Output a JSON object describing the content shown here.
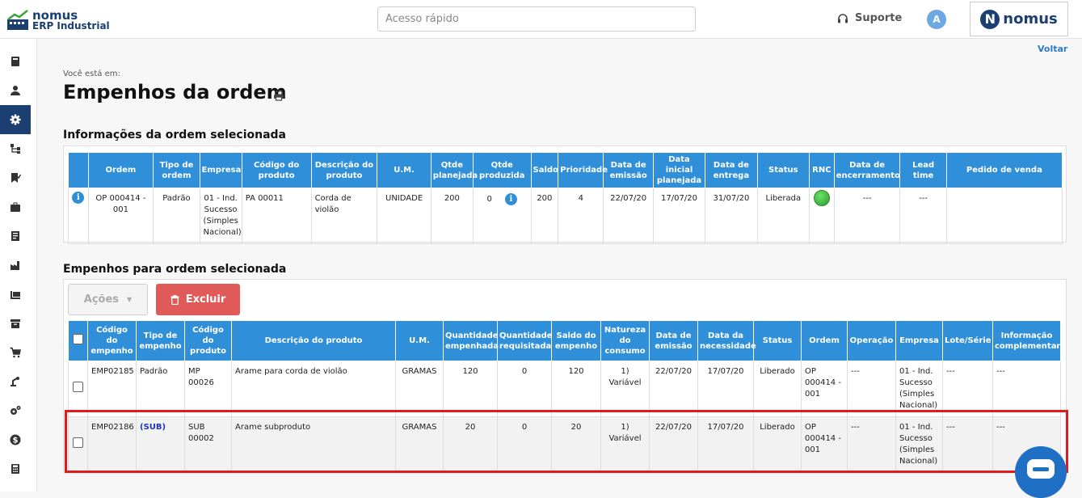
{
  "header": {
    "logo_line1": "nomus",
    "logo_line2": "ERP Industrial",
    "search_placeholder": "Acesso rápido",
    "support_label": "Suporte",
    "avatar_initial": "A",
    "brand": "nomus"
  },
  "sidebar": {
    "icons": [
      "book-icon",
      "user-icon",
      "gear-icon",
      "flow-icon",
      "bookmark-check-icon",
      "briefcase-icon",
      "document-icon",
      "factory-icon",
      "forklift-icon",
      "archive-icon",
      "cart-icon",
      "robot-arm-icon",
      "gears-icon",
      "dollar-icon",
      "calculator-icon"
    ],
    "active_index": 2
  },
  "page": {
    "back_link": "Voltar",
    "breadcrumb": "Você está em:",
    "title": "Empenhos da ordem"
  },
  "order_section": {
    "title": "Informações da ordem selecionada",
    "headers": [
      "",
      "Ordem",
      "Tipo de ordem",
      "Empresa",
      "Código do produto",
      "Descrição do produto",
      "U.M.",
      "Qtde planejada",
      "Qtde produzida",
      "Saldo",
      "Prioridade",
      "Data de emissão",
      "Data inicial planejada",
      "Data de entrega",
      "Status",
      "RNC",
      "Data de encerramento",
      "Lead time",
      "Pedido de venda"
    ],
    "row": {
      "ordem": "OP 000414 - 001",
      "tipo": "Padrão",
      "empresa": "01 - Ind. Sucesso (Simples Nacional)",
      "codigo": "PA 00011",
      "descricao": "Corda de violão",
      "um": "UNIDADE",
      "qtde_planejada": "200",
      "qtde_produzida": "0",
      "saldo": "200",
      "prioridade": "4",
      "data_emissao": "22/07/20",
      "data_inicial": "17/07/20",
      "data_entrega": "31/07/20",
      "status": "Liberada",
      "data_encerramento": "---",
      "lead_time": "---",
      "pedido_venda": ""
    }
  },
  "commitments_section": {
    "title": "Empenhos para ordem selecionada",
    "actions_label": "Ações",
    "delete_label": "Excluir",
    "headers": [
      "Código do empenho",
      "Tipo de empenho",
      "Código do produto",
      "Descrição do produto",
      "U.M.",
      "Quantidade empenhada",
      "Quantidade requisitada",
      "Saldo do empenho",
      "Natureza do consumo",
      "Data de emissão",
      "Data da necessidade",
      "Status",
      "Ordem",
      "Operação",
      "Empresa",
      "Lote/Série",
      "Informação complementar"
    ],
    "rows": [
      {
        "codigo": "EMP02185",
        "tipo": "Padrão",
        "produto": "MP 00026",
        "descricao": "Arame para corda de violão",
        "um": "GRAMAS",
        "qtd_empenhada": "120",
        "qtd_requisitada": "0",
        "saldo": "120",
        "natureza": "1) Variável",
        "data_emissao": "22/07/20",
        "data_necessidade": "17/07/20",
        "status": "Liberado",
        "ordem": "OP 000414 - 001",
        "operacao": "---",
        "empresa": "01 - Ind. Sucesso (Simples Nacional)",
        "lote": "---",
        "info": "---"
      },
      {
        "codigo": "EMP02186",
        "tipo": "(SUB)",
        "produto": "SUB 00002",
        "descricao": "Arame subproduto",
        "um": "GRAMAS",
        "qtd_empenhada": "20",
        "qtd_requisitada": "0",
        "saldo": "20",
        "natureza": "1) Variável",
        "data_emissao": "22/07/20",
        "data_necessidade": "17/07/20",
        "status": "Liberado",
        "ordem": "OP 000414 - 001",
        "operacao": "---",
        "empresa": "01 - Ind. Sucesso (Simples Nacional)",
        "lote": "---",
        "info": "---"
      }
    ]
  },
  "colors": {
    "header_blue": "#2f8fd8",
    "brand_navy": "#1c3f72",
    "delete_red": "#e05a5a",
    "highlight_red": "#e01b1b"
  }
}
